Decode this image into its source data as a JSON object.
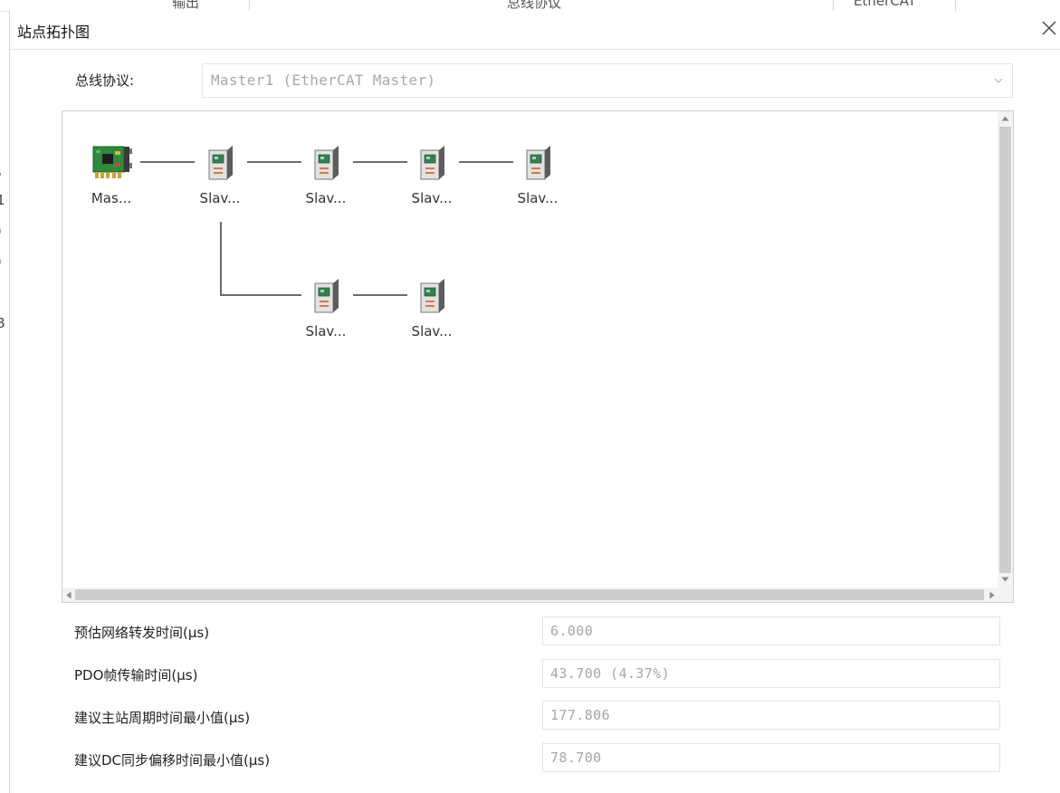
{
  "background": {
    "header_fragments": [
      "输出",
      "总线协议",
      "EtherCAT"
    ],
    "left_glyphs": [
      "\\",
      "1",
      ")",
      ")",
      "I",
      "8"
    ]
  },
  "dialog": {
    "title": "站点拓扑图",
    "close_icon": "close-icon"
  },
  "protocol": {
    "label": "总线协议:",
    "value": "Master1 (EtherCAT Master)"
  },
  "topology": {
    "nodes": [
      {
        "id": "master",
        "label": "Mas...",
        "icon": "master-card-icon"
      },
      {
        "id": "slave1",
        "label": "Slav...",
        "icon": "slave-device-icon"
      },
      {
        "id": "slave2",
        "label": "Slav...",
        "icon": "slave-device-icon"
      },
      {
        "id": "slave3",
        "label": "Slav...",
        "icon": "slave-device-icon"
      },
      {
        "id": "slave4",
        "label": "Slav...",
        "icon": "slave-device-icon"
      },
      {
        "id": "slave5",
        "label": "Slav...",
        "icon": "slave-device-icon"
      },
      {
        "id": "slave6",
        "label": "Slav...",
        "icon": "slave-device-icon"
      }
    ]
  },
  "metrics": [
    {
      "label": "预估网络转发时间(μs)",
      "value": "6.000"
    },
    {
      "label": "PDO帧传输时间(μs)",
      "value": "43.700 (4.37%)"
    },
    {
      "label": "建议主站周期时间最小值(μs)",
      "value": "177.806"
    },
    {
      "label": "建议DC同步偏移时间最小值(μs)",
      "value": "78.700"
    }
  ],
  "colors": {
    "pcb_green": "#2f8a3a",
    "link_gray": "#6b6b6b",
    "placeholder_gray": "#a8a8a8"
  }
}
